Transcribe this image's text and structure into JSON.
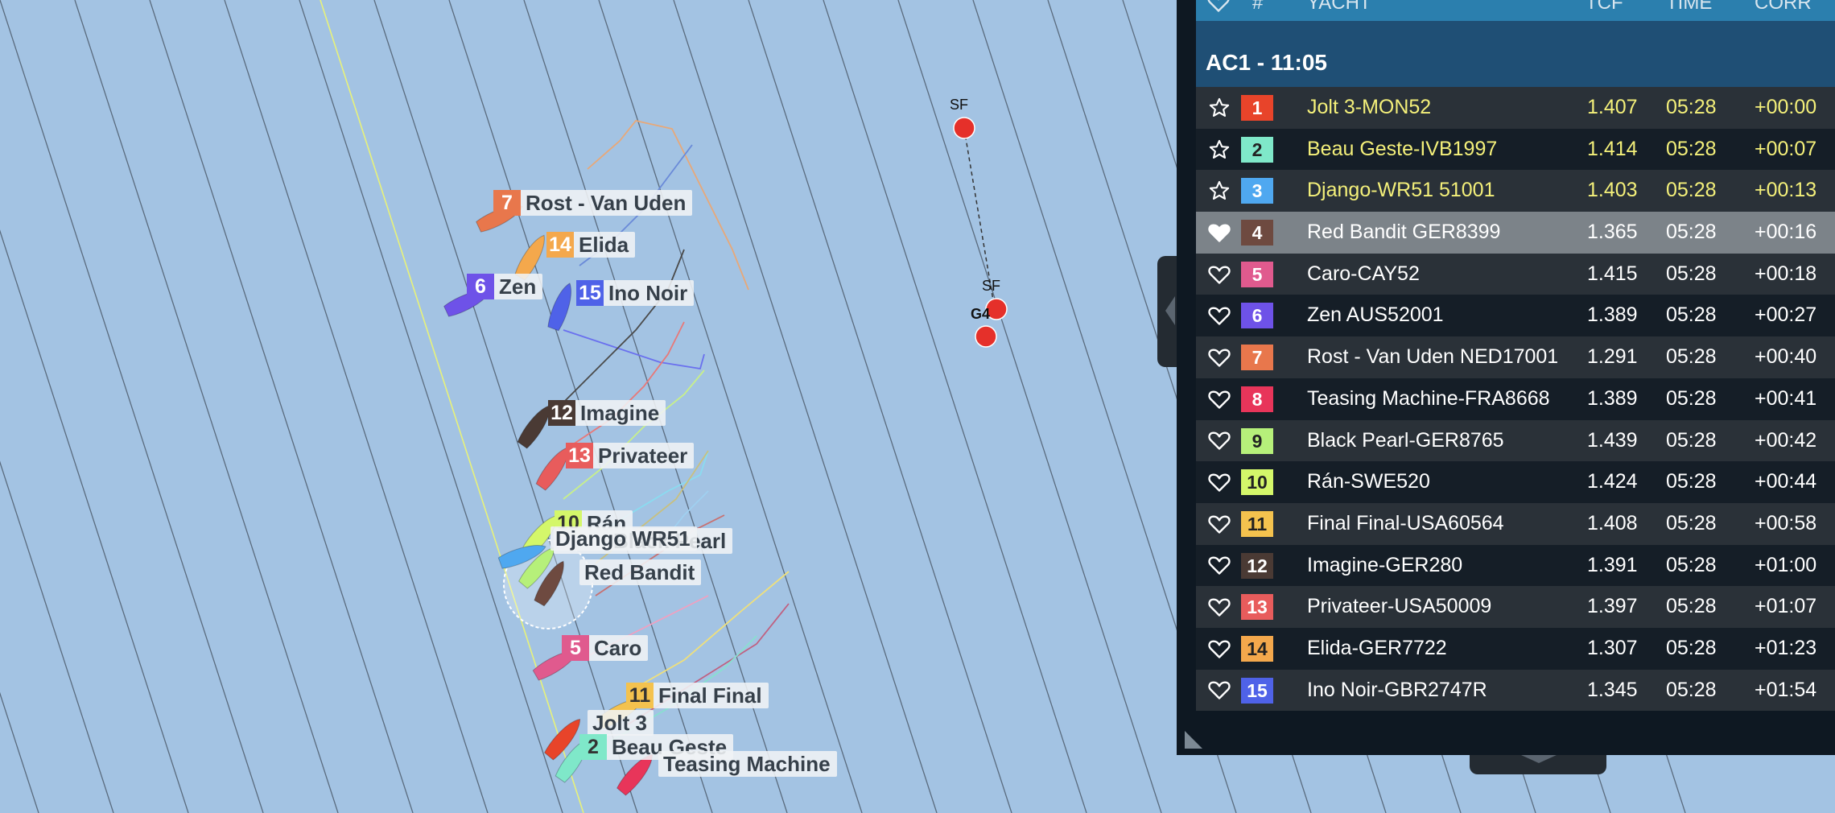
{
  "table": {
    "columns": {
      "fav": "",
      "num": "#",
      "yacht": "YACHT",
      "tcf": "TCF",
      "time": "TIME",
      "corr": "CORR"
    },
    "group_title": "AC1 - 11:05",
    "rows": [
      {
        "num": "1",
        "yacht": "Jolt 3-MON52",
        "tcf": "1.407",
        "time": "05:28",
        "corr": "+00:00",
        "color": "#e8442a",
        "fav_icon": "star-outline-icon"
      },
      {
        "num": "2",
        "yacht": "Beau Geste-IVB1997",
        "tcf": "1.414",
        "time": "05:28",
        "corr": "+00:07",
        "color": "#7fe8c9",
        "fav_icon": "star-outline-icon"
      },
      {
        "num": "3",
        "yacht": "Django-WR51 51001",
        "tcf": "1.403",
        "time": "05:28",
        "corr": "+00:13",
        "color": "#4fa8f0",
        "fav_icon": "star-outline-icon"
      },
      {
        "num": "4",
        "yacht": "Red Bandit GER8399",
        "tcf": "1.365",
        "time": "05:28",
        "corr": "+00:16",
        "color": "#6e4a40",
        "fav_icon": "heart-filled-icon"
      },
      {
        "num": "5",
        "yacht": "Caro-CAY52",
        "tcf": "1.415",
        "time": "05:28",
        "corr": "+00:18",
        "color": "#e05a8e",
        "fav_icon": "heart-outline-icon"
      },
      {
        "num": "6",
        "yacht": "Zen AUS52001",
        "tcf": "1.389",
        "time": "05:28",
        "corr": "+00:27",
        "color": "#6e52e8",
        "fav_icon": "heart-outline-icon"
      },
      {
        "num": "7",
        "yacht": "Rost - Van Uden NED17001",
        "tcf": "1.291",
        "time": "05:28",
        "corr": "+00:40",
        "color": "#e8774c",
        "fav_icon": "heart-outline-icon"
      },
      {
        "num": "8",
        "yacht": "Teasing Machine-FRA8668",
        "tcf": "1.389",
        "time": "05:28",
        "corr": "+00:41",
        "color": "#e8355a",
        "fav_icon": "heart-outline-icon"
      },
      {
        "num": "9",
        "yacht": "Black Pearl-GER8765",
        "tcf": "1.439",
        "time": "05:28",
        "corr": "+00:42",
        "color": "#b6f07a",
        "fav_icon": "heart-outline-icon"
      },
      {
        "num": "10",
        "yacht": "Rán-SWE520",
        "tcf": "1.424",
        "time": "05:28",
        "corr": "+00:44",
        "color": "#d4f76a",
        "fav_icon": "heart-outline-icon"
      },
      {
        "num": "11",
        "yacht": "Final Final-USA60564",
        "tcf": "1.408",
        "time": "05:28",
        "corr": "+00:58",
        "color": "#f4c24e",
        "fav_icon": "heart-outline-icon"
      },
      {
        "num": "12",
        "yacht": "Imagine-GER280",
        "tcf": "1.391",
        "time": "05:28",
        "corr": "+01:00",
        "color": "#4a3a34",
        "fav_icon": "heart-outline-icon"
      },
      {
        "num": "13",
        "yacht": "Privateer-USA50009",
        "tcf": "1.397",
        "time": "05:28",
        "corr": "+01:07",
        "color": "#e85c5c",
        "fav_icon": "heart-outline-icon"
      },
      {
        "num": "14",
        "yacht": "Elida-GER7722",
        "tcf": "1.307",
        "time": "05:28",
        "corr": "+01:23",
        "color": "#f4a84c",
        "fav_icon": "heart-outline-icon"
      },
      {
        "num": "15",
        "yacht": "Ino Noir-GBR2747R",
        "tcf": "1.345",
        "time": "05:28",
        "corr": "+01:54",
        "color": "#4f62e8",
        "fav_icon": "heart-outline-icon"
      }
    ]
  },
  "map": {
    "marks": [
      {
        "label": "SF",
        "color": "#e5302a"
      },
      {
        "label": "SF",
        "color": "#e5302a"
      },
      {
        "label": "G4",
        "color": "#e5302a"
      }
    ],
    "boat_labels": [
      {
        "num": "7",
        "name": "Rost - Van Uden",
        "color": "#e8774c"
      },
      {
        "num": "14",
        "name": "Elida",
        "color": "#f4a84c"
      },
      {
        "num": "6",
        "name": "Zen",
        "color": "#6e52e8"
      },
      {
        "num": "15",
        "name": "Ino Noir",
        "color": "#4f62e8"
      },
      {
        "num": "12",
        "name": "Imagine",
        "color": "#4a3a34"
      },
      {
        "num": "13",
        "name": "Privateer",
        "color": "#e85c5c"
      },
      {
        "num": "10",
        "name": "Rán",
        "color": "#d4f76a"
      },
      {
        "num": "",
        "name": "Django WR51",
        "color": "#4fa8f0"
      },
      {
        "num": "",
        "name": "Black Pearl",
        "color": "#b6f07a"
      },
      {
        "num": "",
        "name": "Red Bandit",
        "color": "#6e4a40"
      },
      {
        "num": "5",
        "name": "Caro",
        "color": "#e05a8e"
      },
      {
        "num": "11",
        "name": "Final Final",
        "color": "#f4c24e"
      },
      {
        "num": "",
        "name": "Jolt 3",
        "color": "#e8442a"
      },
      {
        "num": "2",
        "name": "Beau Geste",
        "color": "#7fe8c9"
      },
      {
        "num": "",
        "name": "Teasing Machine",
        "color": "#e8355a"
      }
    ]
  },
  "colors": {
    "water": "#a3c3e3",
    "laylines": "#5a6b7e",
    "layline_highlight": "#e8f27a",
    "panel_bg": "#0e1822",
    "header_bg": "#2b7fae",
    "group_bg": "#1f4f75",
    "top3_text": "#f4f07a"
  }
}
